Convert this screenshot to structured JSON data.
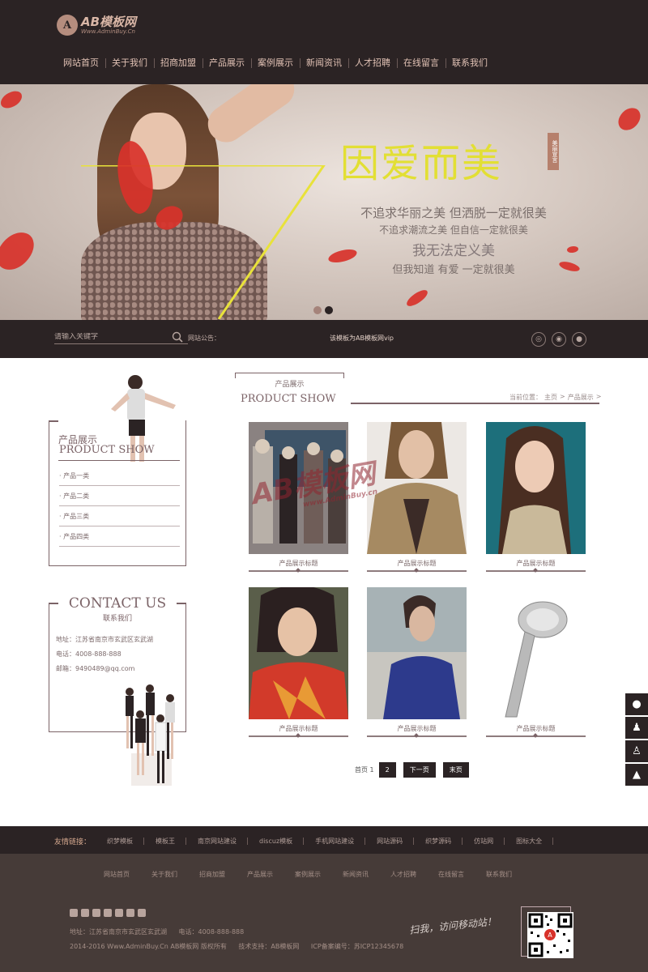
{
  "logo": {
    "name": "AB模板网",
    "url": "Www.AdminBuy.Cn",
    "mark": "A"
  },
  "nav": [
    "网站首页",
    "关于我们",
    "招商加盟",
    "产品展示",
    "案例展示",
    "新闻资讯",
    "人才招聘",
    "在线留言",
    "联系我们"
  ],
  "banner": {
    "title": "因爱而美",
    "stamp": "美丽宣言",
    "lines": [
      "不追求华丽之美 但洒脱一定就很美",
      "不追求潮流之美 但自信一定就很美",
      "我无法定义美",
      "但我知道 有爱 一定就很美"
    ]
  },
  "search": {
    "placeholder": "请输入关键字",
    "notice_label": "网站公告：",
    "notice_text": "该模板为AB模板网vip"
  },
  "social_icons": [
    "weibo-icon",
    "tencent-weibo-icon",
    "wechat-icon"
  ],
  "sidebar": {
    "title_cn": "产品展示",
    "title_en": "PRODUCT SHOW",
    "items": [
      "· 产品一类",
      "· 产品二类",
      "· 产品三类",
      "· 产品四类"
    ]
  },
  "contact": {
    "title": "CONTACT US",
    "sub": "联系我们",
    "address": "地址：江苏省南京市玄武区玄武湖",
    "phone": "电话：4008-888-888",
    "email": "邮箱：9490489@qq.com"
  },
  "main": {
    "tab_label": "产品展示",
    "title_en": "PRODUCT SHOW",
    "breadcrumb": [
      "当前位置：",
      "主页",
      ">",
      "产品展示",
      ">"
    ]
  },
  "products": [
    {
      "caption": "产品展示标题"
    },
    {
      "caption": "产品展示标题"
    },
    {
      "caption": "产品展示标题"
    },
    {
      "caption": "产品展示标题"
    },
    {
      "caption": "产品展示标题"
    },
    {
      "caption": "产品展示标题"
    }
  ],
  "watermark": {
    "text": "AB模板网",
    "url": "www.AdminBuy.cn"
  },
  "pager": {
    "info": "首页 1",
    "current": "2",
    "next": "下一页",
    "last": "末页"
  },
  "float_tools": [
    "wechat-icon",
    "qq-group-icon",
    "qq-icon",
    "back-to-top-icon"
  ],
  "friend_links": {
    "label": "友情链接：",
    "items": [
      "织梦模板",
      "模板王",
      "南京网站建设",
      "discuz模板",
      "手机网站建设",
      "网站源码",
      "织梦源码",
      "仿站网",
      "图标大全"
    ]
  },
  "footer": {
    "nav": [
      "网站首页",
      "关于我们",
      "招商加盟",
      "产品展示",
      "案例展示",
      "新闻资讯",
      "人才招聘",
      "在线留言",
      "联系我们"
    ],
    "address": "地址：江苏省南京市玄武区玄武湖",
    "phone": "电话：4008-888-888",
    "copyright": "2014-2016 Www.AdminBuy.Cn AB模板网 版权所有",
    "support": "技术支持：AB模板网",
    "icp": "ICP备案编号：苏ICP12345678",
    "slogan": "扫我，访问移动站！"
  },
  "colors": {
    "dark": "#2b2324",
    "accent": "#7b6367",
    "banner_title": "#e2df34",
    "petal": "#d8322a"
  }
}
